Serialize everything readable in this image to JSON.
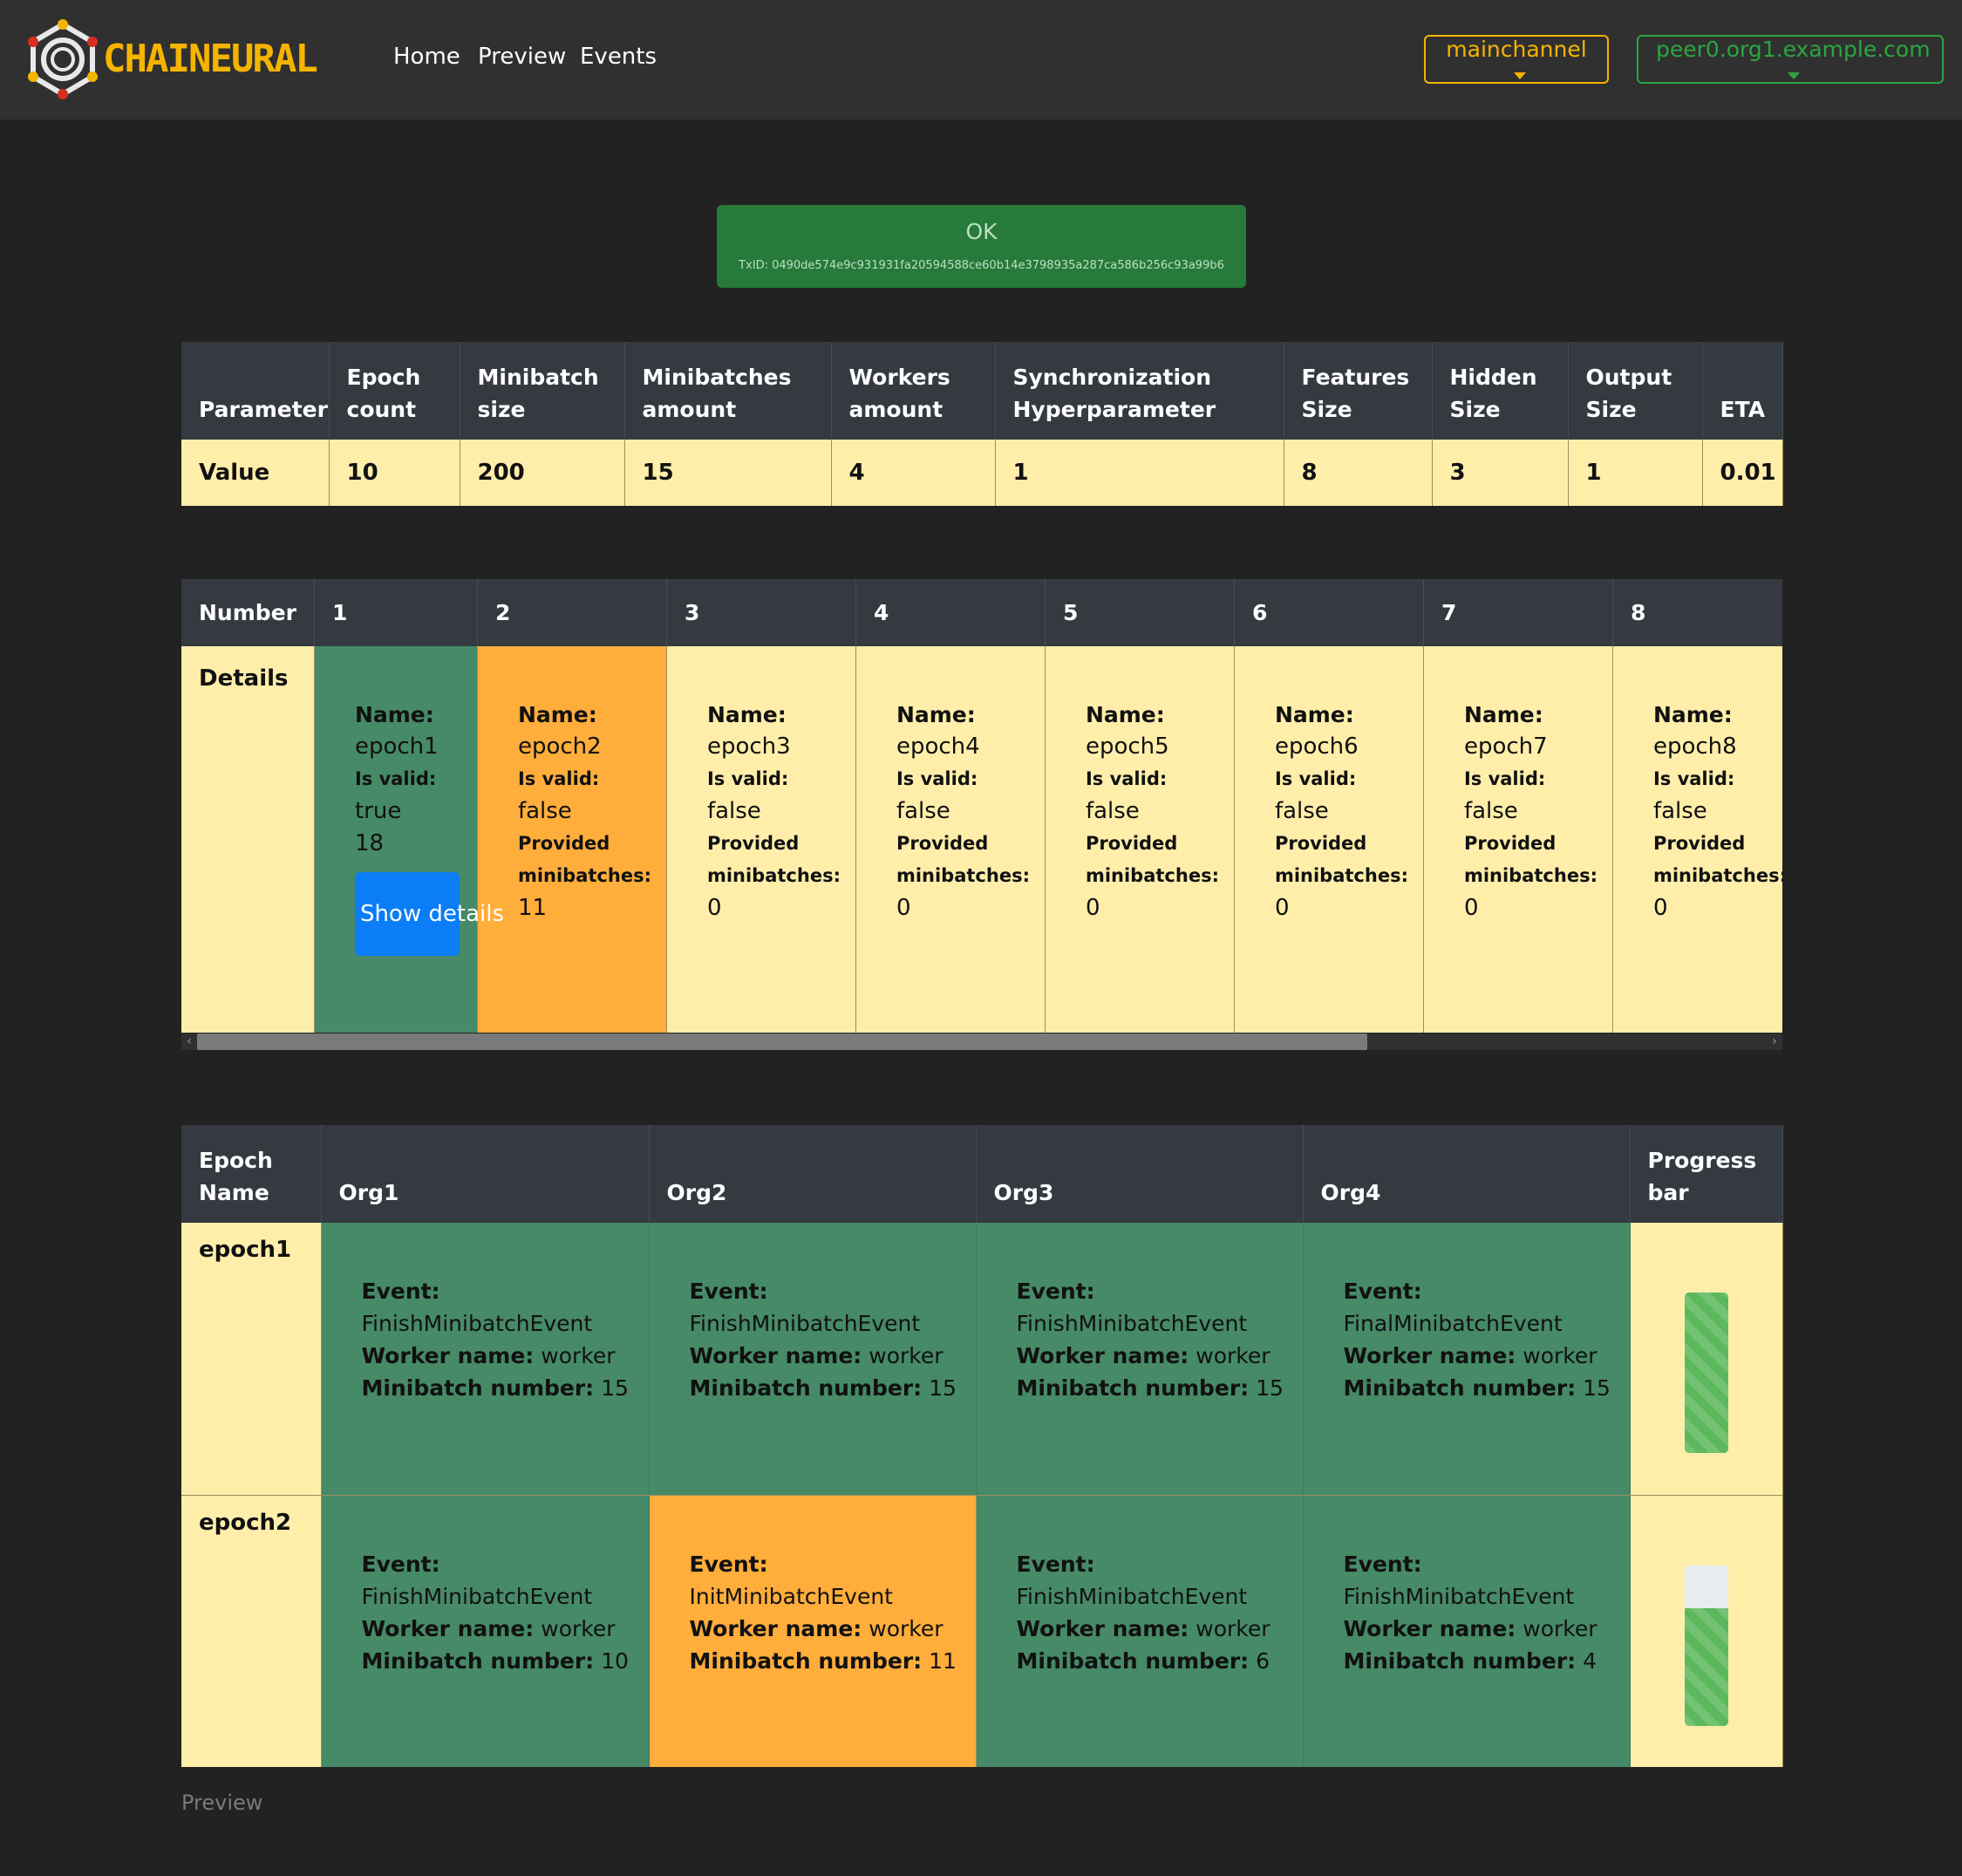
{
  "brand": {
    "name": "CHAINEURAL",
    "color": "#f5b400"
  },
  "nav": {
    "home": "Home",
    "preview": "Preview",
    "events": "Events"
  },
  "dropdowns": {
    "channel": "mainchannel",
    "peer": "peer0.org1.example.com"
  },
  "alert": {
    "title": "OK",
    "txid": "TxID: 0490de574e9c931931fa20594588ce60b14e3798935a287ca586b256c93a99b6"
  },
  "params": {
    "headers": [
      "Parameter",
      "Epoch count",
      "Minibatch size",
      "Minibatches amount",
      "Workers amount",
      "Synchronization Hyperparameter",
      "Features Size",
      "Hidden Size",
      "Output Size",
      "ETA"
    ],
    "values": [
      "Value",
      "10",
      "200",
      "15",
      "4",
      "1",
      "8",
      "3",
      "1",
      "0.01"
    ]
  },
  "epochs": {
    "number_label": "Number",
    "details_label": "Details",
    "name_label": "Name:",
    "valid_label": "Is valid:",
    "provided_label": "Provided minibatches:",
    "show_details": "Show details",
    "items": [
      {
        "number": "1",
        "name": "epoch1",
        "valid": "true",
        "provided": "18",
        "status": "complete"
      },
      {
        "number": "2",
        "name": "epoch2",
        "valid": "false",
        "provided": "11",
        "status": "in-progress"
      },
      {
        "number": "3",
        "name": "epoch3",
        "valid": "false",
        "provided": "0",
        "status": "pending"
      },
      {
        "number": "4",
        "name": "epoch4",
        "valid": "false",
        "provided": "0",
        "status": "pending"
      },
      {
        "number": "5",
        "name": "epoch5",
        "valid": "false",
        "provided": "0",
        "status": "pending"
      },
      {
        "number": "6",
        "name": "epoch6",
        "valid": "false",
        "provided": "0",
        "status": "pending"
      },
      {
        "number": "7",
        "name": "epoch7",
        "valid": "false",
        "provided": "0",
        "status": "pending"
      },
      {
        "number": "8",
        "name": "epoch8",
        "valid": "false",
        "provided": "0",
        "status": "pending"
      }
    ]
  },
  "events": {
    "headers": {
      "epoch_name": "Epoch Name",
      "org1": "Org1",
      "org2": "Org2",
      "org3": "Org3",
      "org4": "Org4",
      "progress": "Progress bar"
    },
    "event_label": "Event:",
    "worker_label": "Worker name:",
    "minibatch_label": "Minibatch number:",
    "rows": [
      {
        "epoch": "epoch1",
        "progress": 1.0,
        "cells": [
          {
            "event": "FinishMinibatchEvent",
            "worker": "worker",
            "minibatch": "15"
          },
          {
            "event": "FinishMinibatchEvent",
            "worker": "worker",
            "minibatch": "15"
          },
          {
            "event": "FinishMinibatchEvent",
            "worker": "worker",
            "minibatch": "15"
          },
          {
            "event": "FinalMinibatchEvent",
            "worker": "worker",
            "minibatch": "15"
          }
        ]
      },
      {
        "epoch": "epoch2",
        "progress": 0.73,
        "cells": [
          {
            "event": "FinishMinibatchEvent",
            "worker": "worker",
            "minibatch": "10"
          },
          {
            "event": "InitMinibatchEvent",
            "worker": "worker",
            "minibatch": "11"
          },
          {
            "event": "FinishMinibatchEvent",
            "worker": "worker",
            "minibatch": "6"
          },
          {
            "event": "FinishMinibatchEvent",
            "worker": "worker",
            "minibatch": "4"
          }
        ]
      }
    ]
  },
  "footer": {
    "text": "Preview"
  },
  "colors": {
    "success": "#468a68",
    "warning": "#ffad3b",
    "pending": "#ffeeaa",
    "header": "#343a40",
    "primary": "#0b7df7"
  }
}
